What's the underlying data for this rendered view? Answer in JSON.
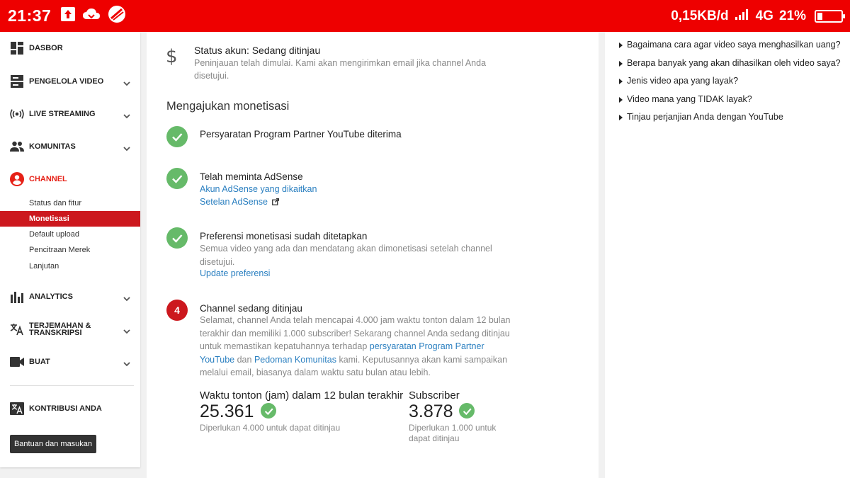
{
  "statusbar": {
    "time": "21:37",
    "net_speed": "0,15KB/d",
    "network": "4G",
    "battery": "21%",
    "battery_level": 0.21,
    "bg_color": "#ee0000"
  },
  "sidebar": {
    "items": [
      {
        "label": "DASBOR",
        "icon": "dashboard-icon"
      },
      {
        "label": "PENGELOLA VIDEO",
        "icon": "video-manager-icon"
      },
      {
        "label": "LIVE STREAMING",
        "icon": "live-streaming-icon"
      },
      {
        "label": "KOMUNITAS",
        "icon": "community-icon"
      },
      {
        "label": "CHANNEL",
        "icon": "channel-icon"
      },
      {
        "label": "ANALYTICS",
        "icon": "analytics-icon"
      },
      {
        "label": "TERJEMAHAN &",
        "label2": "TRANSKRIPSI",
        "icon": "translate-icon"
      },
      {
        "label": "BUAT",
        "icon": "create-icon"
      },
      {
        "label": "KONTRIBUSI ANDA",
        "icon": "contribute-icon"
      }
    ],
    "channel_sub": [
      "Status dan fitur",
      "Monetisasi",
      "Default upload",
      "Pencitraan Merek",
      "Lanjutan"
    ],
    "help_button": "Bantuan dan masukan",
    "active_color": "#cc181e"
  },
  "main": {
    "account_status": {
      "title": "Status akun: Sedang ditinjau",
      "desc": "Peninjauan telah dimulai. Kami akan mengirimkan email jika channel Anda disetujui."
    },
    "section_title": "Mengajukan monetisasi",
    "steps": [
      {
        "title": "Persyaratan Program Partner YouTube diterima"
      },
      {
        "title": "Telah meminta AdSense",
        "link1": "Akun AdSense yang dikaitkan",
        "link2": "Setelan AdSense"
      },
      {
        "title": "Preferensi monetisasi sudah ditetapkan",
        "desc": "Semua video yang ada dan mendatang akan dimonetisasi setelah channel disetujui.",
        "link": "Update preferensi"
      },
      {
        "number": "4",
        "title": "Channel sedang ditinjau",
        "desc_part1": "Selamat, channel Anda telah mencapai 4.000 jam waktu tonton dalam 12 bulan terakhir dan memiliki 1.000 subscriber! Sekarang channel Anda sedang ditinjau untuk memastikan kepatuhannya terhadap ",
        "desc_link1": "persyaratan Program Partner YouTube",
        "desc_part2": " dan ",
        "desc_link2": "Pedoman Komunitas",
        "desc_part3": " kami. Keputusannya akan kami sampaikan melalui email, biasanya dalam waktu satu bulan atau lebih."
      }
    ],
    "metrics": [
      {
        "label": "Waktu tonton (jam) dalam 12 bulan terakhir",
        "value": "25.361",
        "requirement": "Diperlukan 4.000 untuk dapat ditinjau"
      },
      {
        "label": "Subscriber",
        "value": "3.878",
        "requirement": "Diperlukan 1.000 untuk dapat ditinjau"
      }
    ],
    "check_color": "#4caf50",
    "link_color": "#2a7fc0"
  },
  "faq": [
    "Bagaimana cara agar video saya menghasilkan uang?",
    "Berapa banyak yang akan dihasilkan oleh video saya?",
    "Jenis video apa yang layak?",
    "Video mana yang TIDAK layak?",
    "Tinjau perjanjian Anda dengan YouTube"
  ]
}
